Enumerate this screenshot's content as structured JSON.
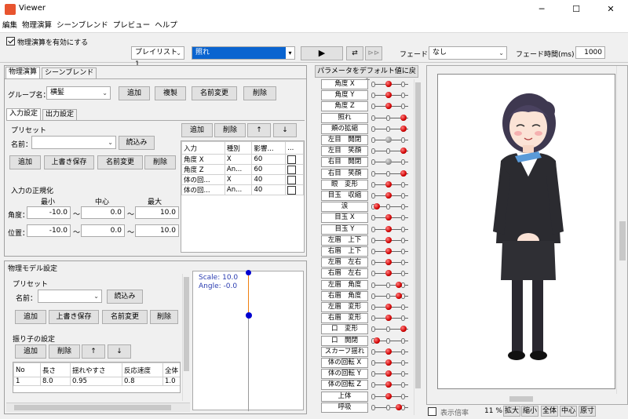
{
  "window": {
    "title": "Viewer",
    "minimize": "─",
    "maximize": "☐",
    "close": "✕"
  },
  "menu": [
    "編集",
    "物理演算",
    "シーンブレンド",
    "プレビュー",
    "ヘルプ"
  ],
  "toolbar": {
    "physics_label": "物理演算を有効にする",
    "playlist_value": "プレイリスト 1",
    "motion_value": "照れ",
    "fade_label": "フェード：",
    "fade_value": "なし",
    "fade_time_label": "フェード時間(ms)：",
    "fade_time_value": "1000"
  },
  "physics_panel": {
    "tabs": [
      "物理演算",
      "シーンブレンド"
    ],
    "group_label": "グループ名：",
    "group_value": "横髪",
    "group_buttons": [
      "追加",
      "複製",
      "名前変更",
      "削除"
    ],
    "subtabs": [
      "入力設定",
      "出力設定"
    ],
    "preset_title": "プリセット",
    "preset_name_label": "名前：",
    "preset_load": "読込み",
    "preset_buttons": [
      "追加",
      "上書き保存",
      "名前変更",
      "削除"
    ],
    "input_buttons": [
      "追加",
      "削除",
      "↑",
      "↓"
    ],
    "input_columns": [
      "入力",
      "種別",
      "影響...",
      "..."
    ],
    "input_rows": [
      {
        "input": "角度 X",
        "type": "X",
        "weight": "60"
      },
      {
        "input": "角度 Z",
        "type": "An...",
        "weight": "60"
      },
      {
        "input": "体の回...",
        "type": "X",
        "weight": "40"
      },
      {
        "input": "体の回...",
        "type": "An...",
        "weight": "40"
      }
    ],
    "normalize_title": "入力の正規化",
    "norm_headers": [
      "最小",
      "中心",
      "最大"
    ],
    "angle_label": "角度：",
    "angle_values": [
      "-10.0",
      "0.0",
      "10.0"
    ],
    "position_label": "位置：",
    "position_values": [
      "-10.0",
      "0.0",
      "10.0"
    ],
    "tilde": "～"
  },
  "model_panel": {
    "title": "物理モデル設定",
    "preset_title": "プリセット",
    "name_label": "名前：",
    "load": "読込み",
    "preset_buttons": [
      "追加",
      "上書き保存",
      "名前変更",
      "削除"
    ],
    "pendulum_title": "振り子の設定",
    "pendulum_buttons": [
      "追加",
      "削除",
      "↑",
      "↓"
    ],
    "columns": [
      "No",
      "長さ",
      "揺れやすさ",
      "反応速度",
      "全体"
    ],
    "rows": [
      [
        "1",
        "8.0",
        "0.95",
        "0.8",
        "1.0"
      ]
    ],
    "scale_text": "Scale: 10.0",
    "angle_text": "Angle: -0.0"
  },
  "params": {
    "reset_label": "パラメータをデフォルト値に戻す",
    "items": [
      {
        "label": "角度 X",
        "knob": 0.45,
        "gray": false
      },
      {
        "label": "角度 Y",
        "knob": 0.45,
        "gray": false
      },
      {
        "label": "角度 Z",
        "knob": 0.45,
        "gray": false
      },
      {
        "label": "照れ",
        "knob": 0.9,
        "gray": false
      },
      {
        "label": "頬の拡縮",
        "knob": 0.9,
        "gray": false
      },
      {
        "label": "左目　開閉",
        "knob": 0.45,
        "gray": true
      },
      {
        "label": "左目　笑顔",
        "knob": 0.9,
        "gray": false
      },
      {
        "label": "右目　開閉",
        "knob": 0.45,
        "gray": true
      },
      {
        "label": "右目　笑顔",
        "knob": 0.9,
        "gray": false
      },
      {
        "label": "眼　変形",
        "knob": 0.45,
        "gray": false
      },
      {
        "label": "目玉　収縮",
        "knob": 0.45,
        "gray": false
      },
      {
        "label": "涙",
        "knob": 0.1,
        "gray": false
      },
      {
        "label": "目玉 X",
        "knob": 0.45,
        "gray": false
      },
      {
        "label": "目玉 Y",
        "knob": 0.45,
        "gray": false
      },
      {
        "label": "左眉　上下",
        "knob": 0.45,
        "gray": false
      },
      {
        "label": "右眉　上下",
        "knob": 0.45,
        "gray": false
      },
      {
        "label": "左眉　左右",
        "knob": 0.45,
        "gray": false
      },
      {
        "label": "右眉　左右",
        "knob": 0.45,
        "gray": false
      },
      {
        "label": "左眉　角度",
        "knob": 0.75,
        "gray": false
      },
      {
        "label": "右眉　角度",
        "knob": 0.75,
        "gray": false
      },
      {
        "label": "左眉　変形",
        "knob": 0.45,
        "gray": false
      },
      {
        "label": "右眉　変形",
        "knob": 0.45,
        "gray": false
      },
      {
        "label": "口　変形",
        "knob": 0.9,
        "gray": false
      },
      {
        "label": "口　開閉",
        "knob": 0.1,
        "gray": false
      },
      {
        "label": "スカーフ揺れ",
        "knob": 0.45,
        "gray": false
      },
      {
        "label": "体の回転 X",
        "knob": 0.45,
        "gray": false
      },
      {
        "label": "体の回転 Y",
        "knob": 0.45,
        "gray": false
      },
      {
        "label": "体の回転 Z",
        "knob": 0.45,
        "gray": false
      },
      {
        "label": "上体",
        "knob": 0.45,
        "gray": false
      },
      {
        "label": "呼吸",
        "knob": 0.75,
        "gray": false
      }
    ]
  },
  "viewport": {
    "scale_label": "表示倍率",
    "scale_value": "11 %",
    "buttons": [
      "拡大",
      "縮小",
      "全体",
      "中心",
      "原寸"
    ]
  }
}
